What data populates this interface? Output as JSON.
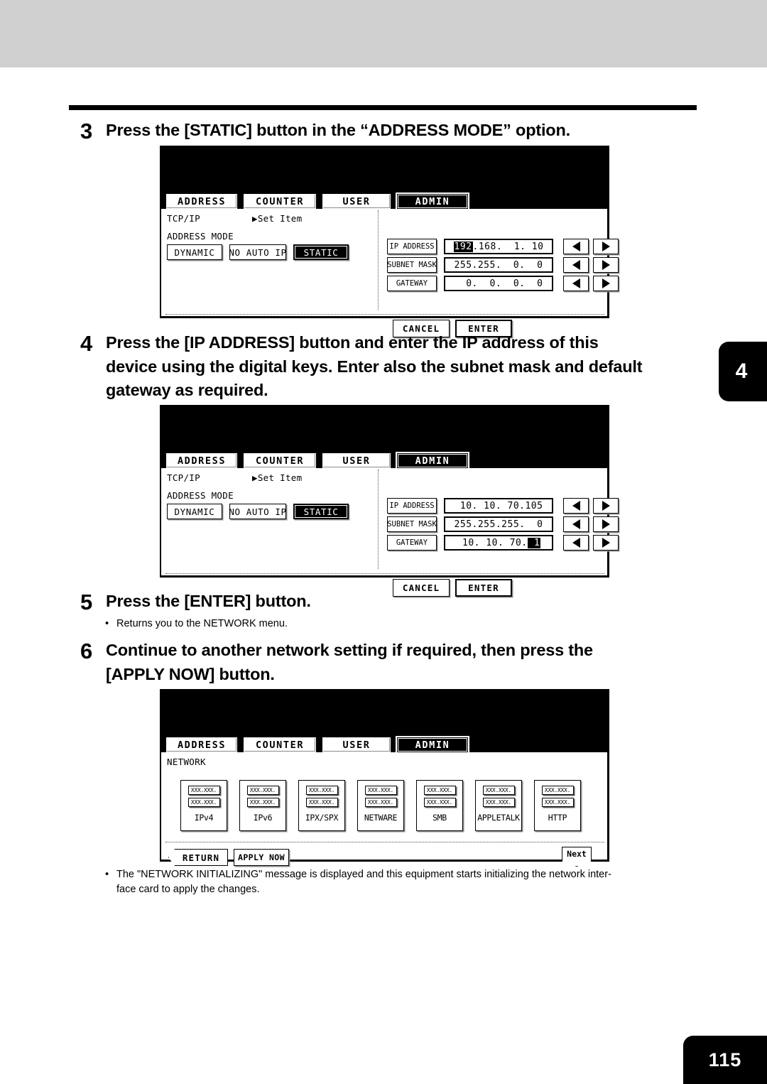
{
  "page": {
    "number": "115",
    "side_tab": "4"
  },
  "steps": [
    {
      "num": "3",
      "text": "Press the [STATIC] button in the “ADDRESS MODE” option."
    },
    {
      "num": "4",
      "line1": "Press the [IP ADDRESS] button and enter the IP address of this",
      "line2": "device using the digital keys.  Enter also the subnet mask and default",
      "line3": "gateway as required."
    },
    {
      "num": "5",
      "text": "Press the [ENTER] button.",
      "note": "Returns you to the NETWORK menu."
    },
    {
      "num": "6",
      "line1": "Continue to another network setting if required, then press the",
      "line2": "[APPLY NOW] button."
    }
  ],
  "notes": {
    "bottom_line1": "The \"NETWORK INITIALIZING\" message is displayed and this equipment starts initializing the network inter-",
    "bottom_line2": "face card to apply the changes.",
    "bullet_char": "•"
  },
  "tabs": [
    {
      "label": "ADDRESS",
      "selected": false
    },
    {
      "label": "COUNTER",
      "selected": false
    },
    {
      "label": "USER",
      "selected": false
    },
    {
      "label": "ADMIN",
      "selected": true
    }
  ],
  "screen1": {
    "menu_path": "TCP/IP",
    "set_item": "▶Set Item",
    "address_mode_label": "ADDRESS MODE",
    "mode_buttons": [
      {
        "label": "DYNAMIC",
        "selected": false
      },
      {
        "label": "NO AUTO IP",
        "selected": false
      },
      {
        "label": "STATIC",
        "selected": true
      }
    ],
    "fields": [
      {
        "label": "IP ADDRESS",
        "highlight": "192",
        "value": ".168.  1. 10"
      },
      {
        "label": "SUBNET MASK",
        "highlight": "",
        "value": "255.255.  0.  0"
      },
      {
        "label": "GATEWAY",
        "highlight": "",
        "value": "  0.  0.  0.  0"
      }
    ],
    "cancel_label": "CANCEL",
    "enter_label": "ENTER"
  },
  "screen2": {
    "menu_path": "TCP/IP",
    "set_item": "▶Set Item",
    "address_mode_label": "ADDRESS MODE",
    "mode_buttons": [
      {
        "label": "DYNAMIC",
        "selected": false
      },
      {
        "label": "NO AUTO IP",
        "selected": false
      },
      {
        "label": "STATIC",
        "selected": true
      }
    ],
    "fields": [
      {
        "label": "IP ADDRESS",
        "pre": " 10. 10. 70.105",
        "highlight": "",
        "post": ""
      },
      {
        "label": "SUBNET MASK",
        "pre": "255.255.255.  0",
        "highlight": "",
        "post": ""
      },
      {
        "label": "GATEWAY",
        "pre": " 10. 10. 70.",
        "highlight": " 1",
        "post": ""
      }
    ],
    "cancel_label": "CANCEL",
    "enter_label": "ENTER"
  },
  "screen3": {
    "menu_path": "NETWORK",
    "xxx_text": "XXX.XXX.",
    "net_buttons": [
      {
        "label": "IPv4"
      },
      {
        "label": "IPv6"
      },
      {
        "label": "IPX/SPX"
      },
      {
        "label": "NETWARE"
      },
      {
        "label": "SMB"
      },
      {
        "label": "APPLETALK"
      },
      {
        "label": "HTTP"
      }
    ],
    "return_label": "RETURN",
    "apply_now_label": "APPLY NOW",
    "next_label": "Next"
  },
  "colors": {
    "band": "#d0d0d0",
    "ink": "#000000",
    "paper": "#ffffff"
  }
}
